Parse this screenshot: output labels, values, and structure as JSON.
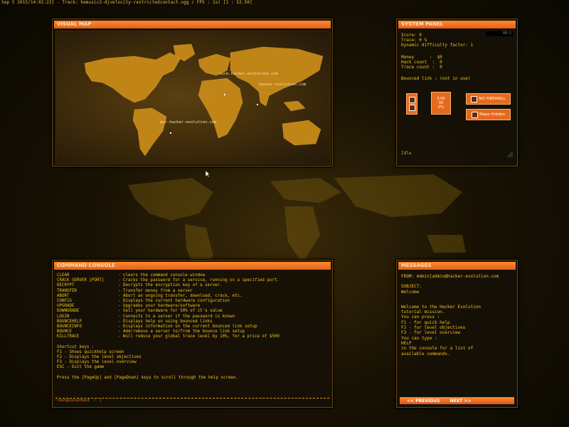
{
  "status_bar": "Sep  5 2015/14:02:22] - Track: hemusic3-djvelocity-restrictedcontact.ogg / FPS :  1s( [1 : 52.50]",
  "map": {
    "title": "VISUAL MAP",
    "servers": [
      "core.hacker-evolution.com",
      "hacker-evolution.com",
      "pwr.hacker-evolution.com"
    ]
  },
  "system": {
    "title": "SYSTEM PANEL",
    "corner": "00:1",
    "score": "Score: 0",
    "trace": "Trace: 0 %",
    "difficulty": "Dynamic difficulty factor: 1",
    "money": "Money      :  $0",
    "hack_count": "Hack count  :  0",
    "trace_count": "Trace count :  0",
    "bounced": "Bounced link : (not in use)",
    "idle": "Idle",
    "buttons": {
      "b1": "",
      "b2a": "3:00",
      "b2b": "00",
      "b2c": "0%",
      "no_firewall": "NO FIREWALL",
      "maps_hidden": "Maps Hidden"
    }
  },
  "console": {
    "title": "COMMAND CONSOLE",
    "commands": [
      {
        "name": "CLEAR",
        "desc": "- clears the command console window"
      },
      {
        "name": "CRACK SERVER [PORT]",
        "desc": "- Cracks the password for a service, running on a specified port."
      },
      {
        "name": "DECRYPT",
        "desc": "- Decrypts the encryption key of a server."
      },
      {
        "name": "TRANSFER",
        "desc": "- Transfer money from a server"
      },
      {
        "name": "ABORT",
        "desc": "- Abort an ongoing transfer, download, crack, etc."
      },
      {
        "name": "CONFIG",
        "desc": "- Displays the current hardware configuration"
      },
      {
        "name": "UPGRADE",
        "desc": "- Upgrades your hardware/software"
      },
      {
        "name": "DOWNGRADE",
        "desc": "- Sell your hardware for 50% of it's value"
      },
      {
        "name": "LOGIN",
        "desc": "- Connects to a server if the password is known"
      },
      {
        "name": "BOUNCEHELP",
        "desc": "- Displays help on using bounced links"
      },
      {
        "name": "BOUNCEINFO",
        "desc": "- Displays information on the current bounced link setup"
      },
      {
        "name": "BOUNCE",
        "desc": "- Add/remove a server to/from the bounce link setup"
      },
      {
        "name": "KILLTRACE",
        "desc": "- Will reduce your global trace level by 10%, for a price of $500"
      }
    ],
    "shortcut_title": "Shortcut keys :",
    "shortcuts": [
      "F1  - Shows quickhelp screen",
      "F2  - Displays the level objectives",
      "F3  - Displays the level overview",
      "ESC - Exit the game"
    ],
    "scroll_hint": "Press the [PageUp] and [PageDown] keys to scroll through the help screen.",
    "prompt": "root@localhost :: |"
  },
  "messages": {
    "title": "MESSAGES",
    "from": "FROM: Admin[admin@hacker-evolution.com",
    "subject_label": "SUBJECT:",
    "subject": "Welcome",
    "body": [
      "Welcome to the Hacker Evolution",
      "tutorial mission.",
      "",
      "You can press :",
      "F1 - for quick help",
      "F2 - for level objectives",
      "F3 - for level overview",
      "",
      "You can type :",
      "HELP",
      "",
      "in the console for a list of",
      "available commands."
    ],
    "prev": "<< PREVIOUS",
    "next": "NEXT >>"
  }
}
